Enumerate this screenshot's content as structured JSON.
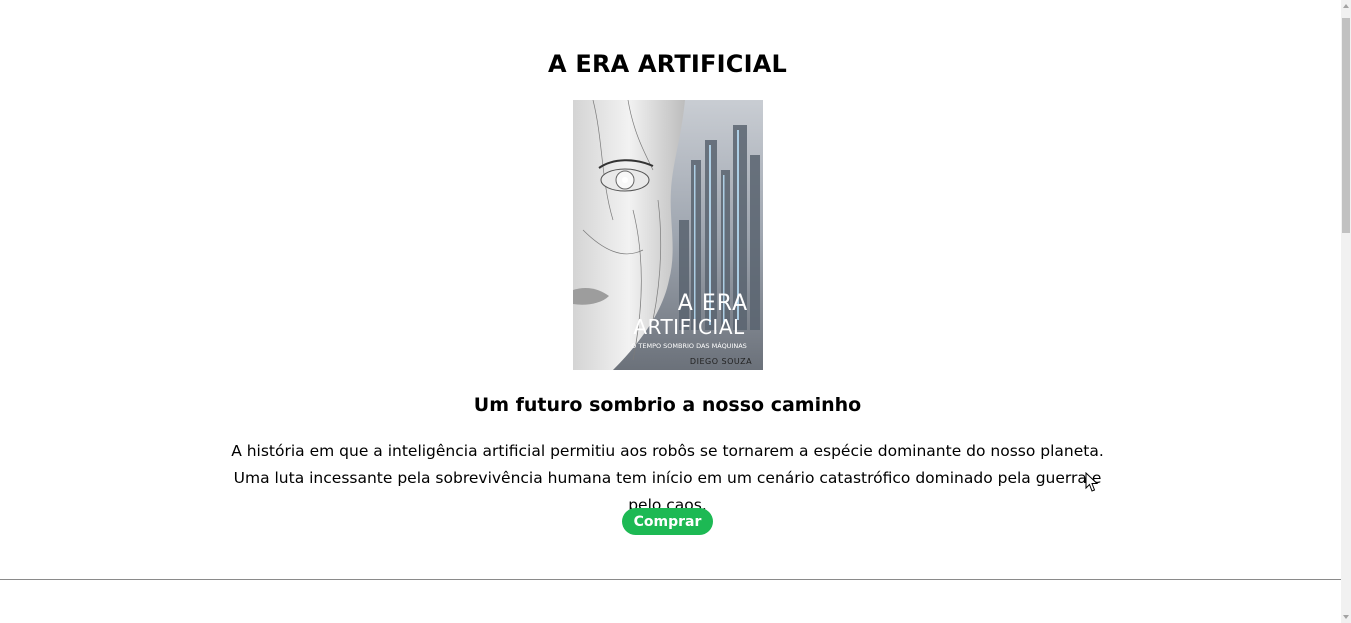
{
  "product": {
    "title": "A ERA ARTIFICIAL",
    "cover": {
      "title_line1": "A ERA",
      "title_line2": "ARTIFICIAL",
      "tagline": "O TEMPO SOMBRIO DAS MÁQUINAS",
      "author": "DIEGO SOUZA"
    },
    "subtitle": "Um futuro sombrio a nosso caminho",
    "description": "A história em que a inteligência artificial permitiu aos robôs se tornarem a espécie dominante do nosso planeta. Uma luta incessante pela sobrevivência humana tem início em um cenário catastrófico dominado pela guerra e pelo caos.",
    "buy_label": "Comprar"
  },
  "colors": {
    "buy_button": "#1db954",
    "divider": "#8a8a8a"
  },
  "icons": [
    "cursor-arrow-icon",
    "scroll-up-icon",
    "scroll-down-icon"
  ]
}
